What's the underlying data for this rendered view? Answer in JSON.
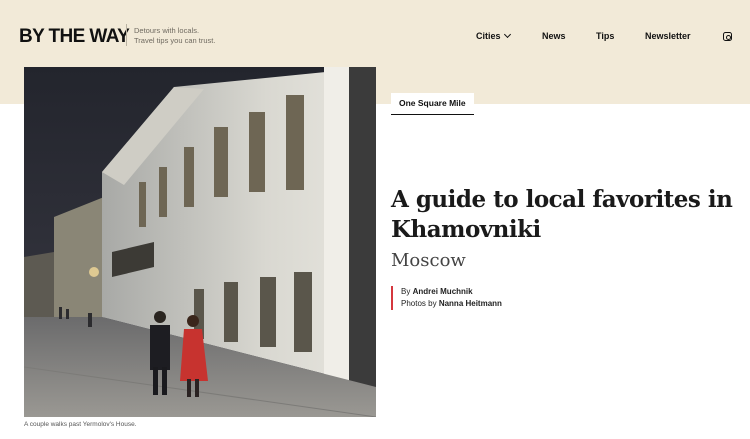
{
  "brand": {
    "logo": "BY THE WAY",
    "tagline": [
      "Detours with locals.",
      "Travel tips you can trust."
    ]
  },
  "nav": {
    "items": [
      {
        "label": "Cities",
        "has_dropdown": true
      },
      {
        "label": "News"
      },
      {
        "label": "Tips"
      },
      {
        "label": "Newsletter"
      }
    ],
    "social_icon": "instagram-icon"
  },
  "article": {
    "section": "One Square Mile",
    "headline": "A guide to local favorites in Khamovniki",
    "subhead": "Moscow",
    "byline": {
      "by_prefix": "By",
      "author": "Andrei Muchnik",
      "photos_prefix": "Photos by",
      "photographer": "Nanna Heitmann"
    },
    "photo_caption": "A couple walks past Yermolov's House."
  },
  "colors": {
    "header_band": "#f2ead8",
    "byline_accent": "#d5373e",
    "text": "#1a1a1a"
  }
}
